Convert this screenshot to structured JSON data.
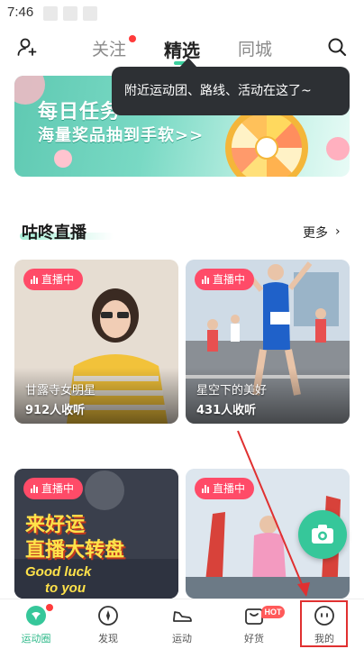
{
  "status": {
    "time": "7:46"
  },
  "header": {
    "tabs": [
      {
        "label": "关注",
        "has_dot": true
      },
      {
        "label": "精选",
        "active": true
      },
      {
        "label": "同城"
      }
    ]
  },
  "tooltip": {
    "text": "附近运动团、路线、活动在这了~"
  },
  "banner": {
    "line1": "每日任务",
    "line2": "海量奖品抽到手软>>"
  },
  "live_section": {
    "title": "咕咚直播",
    "more_label": "更多",
    "more_chevron": "›"
  },
  "live_cards": [
    {
      "badge": "直播中",
      "title": "甘露寺女明星",
      "listeners": "912人收听"
    },
    {
      "badge": "直播中",
      "title": "星空下的美好",
      "listeners": "431人收听"
    },
    {
      "badge": "直播中",
      "overlay_line1": "来好运",
      "overlay_line2": "直播大转盘",
      "overlay_line3": "Good luck",
      "overlay_line4": "to you"
    },
    {
      "badge": "直播中"
    }
  ],
  "bottom_nav": [
    {
      "label": "运动圈",
      "icon": "sport-circle-icon",
      "active": true
    },
    {
      "label": "发现",
      "icon": "compass-icon"
    },
    {
      "label": "运动",
      "icon": "sneaker-icon"
    },
    {
      "label": "好货",
      "icon": "shopping-bag-icon",
      "badge": "HOT"
    },
    {
      "label": "我的",
      "icon": "profile-icon"
    }
  ],
  "colors": {
    "accent": "#36c79a",
    "live_badge": "#ff4b68",
    "annotation": "#e03030"
  }
}
